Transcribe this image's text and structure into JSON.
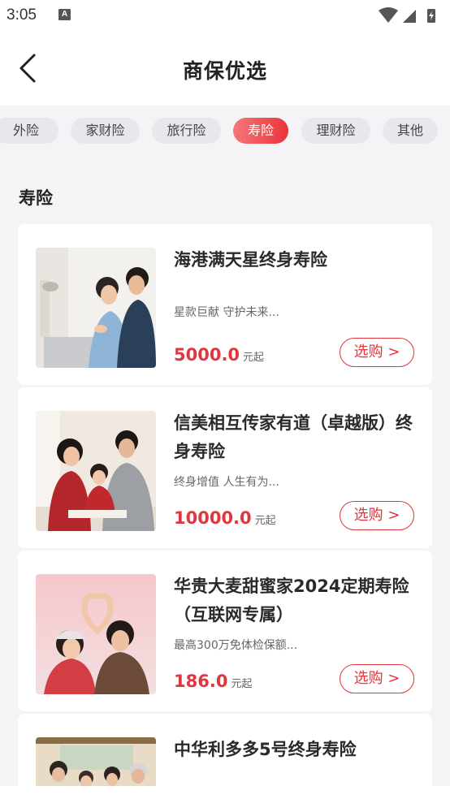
{
  "status_bar": {
    "time": "3:05",
    "notification_icon": "A"
  },
  "header": {
    "title": "商保优选",
    "back_icon": "chevron-left-icon"
  },
  "tabs": [
    {
      "label": "外险",
      "active": false
    },
    {
      "label": "家财险",
      "active": false
    },
    {
      "label": "旅行险",
      "active": false
    },
    {
      "label": "寿险",
      "active": true
    },
    {
      "label": "理财险",
      "active": false
    },
    {
      "label": "其他",
      "active": false
    }
  ],
  "section": {
    "title": "寿险"
  },
  "products": [
    {
      "title": "海港满天星终身寿险",
      "desc": "星款巨献 守护未来...",
      "price": "5000.0",
      "unit": "元起",
      "button": "选购 >"
    },
    {
      "title": "信美相互传家有道（卓越版）终身寿险",
      "desc": "终身增值 人生有为...",
      "price": "10000.0",
      "unit": "元起",
      "button": "选购 >"
    },
    {
      "title": "华贵大麦甜蜜家2024定期寿险（互联网专属）",
      "desc": "最高300万免体检保额...",
      "price": "186.0",
      "unit": "元起",
      "button": "选购 >"
    },
    {
      "title": "中华利多多5号终身寿险"
    }
  ],
  "colors": {
    "accent": "#e0363d",
    "accent_light": "#f4777a",
    "background": "#f4f4f6"
  }
}
